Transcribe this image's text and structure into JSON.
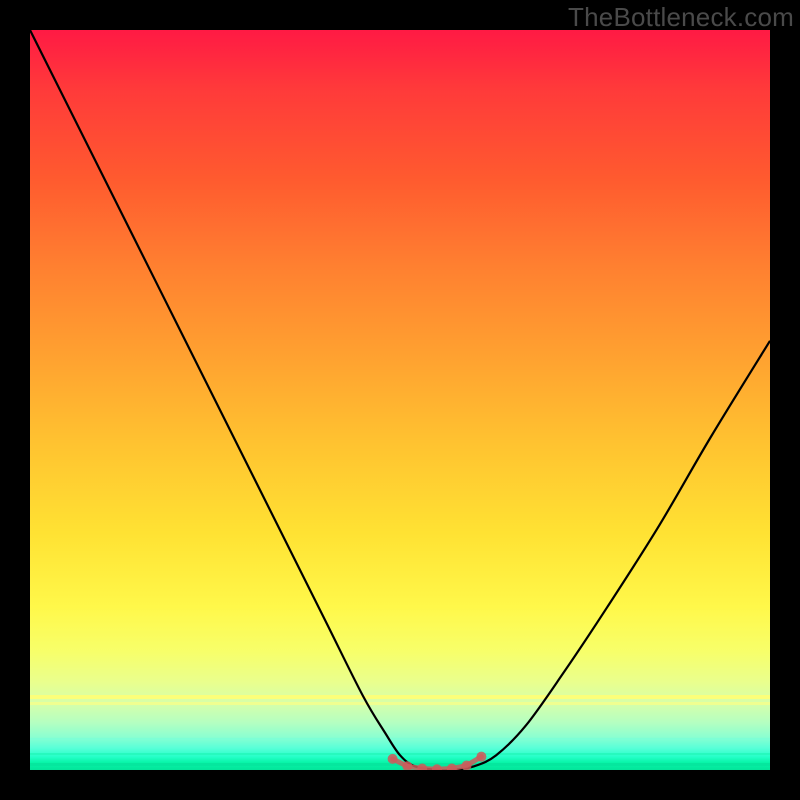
{
  "watermark": "TheBottleneck.com",
  "colors": {
    "background": "#000000",
    "curve_stroke": "#000000",
    "marker_stroke": "#cc5a5a",
    "marker_fill": "#cc5a5a",
    "watermark": "#4a4a4a"
  },
  "chart_data": {
    "type": "line",
    "title": "",
    "xlabel": "",
    "ylabel": "",
    "xlim": [
      0,
      100
    ],
    "ylim": [
      0,
      100
    ],
    "grid": false,
    "legend": false,
    "series": [
      {
        "name": "bottleneck-curve",
        "x": [
          0,
          5,
          10,
          15,
          20,
          25,
          30,
          35,
          40,
          45,
          48,
          50,
          52,
          55,
          57,
          60,
          63,
          67,
          72,
          78,
          85,
          92,
          100
        ],
        "y": [
          100,
          90,
          80,
          70,
          60,
          50,
          40,
          30,
          20,
          10,
          5,
          2,
          0.5,
          0,
          0,
          0.5,
          2,
          6,
          13,
          22,
          33,
          45,
          58
        ]
      },
      {
        "name": "valley-markers",
        "x": [
          49,
          51,
          53,
          55,
          57,
          59,
          61
        ],
        "y": [
          1.5,
          0.5,
          0.2,
          0.1,
          0.2,
          0.6,
          1.8
        ]
      }
    ],
    "notes": "No axis ticks or numeric labels are shown; values are estimated on a 0–100 normalized scale for both axes. The curve descends steeply from the top-left, reaches a flat minimum near x≈52–60, and rises more gently toward the right reaching roughly y≈58 at x=100. Small salmon-colored markers sit along the valley floor."
  }
}
